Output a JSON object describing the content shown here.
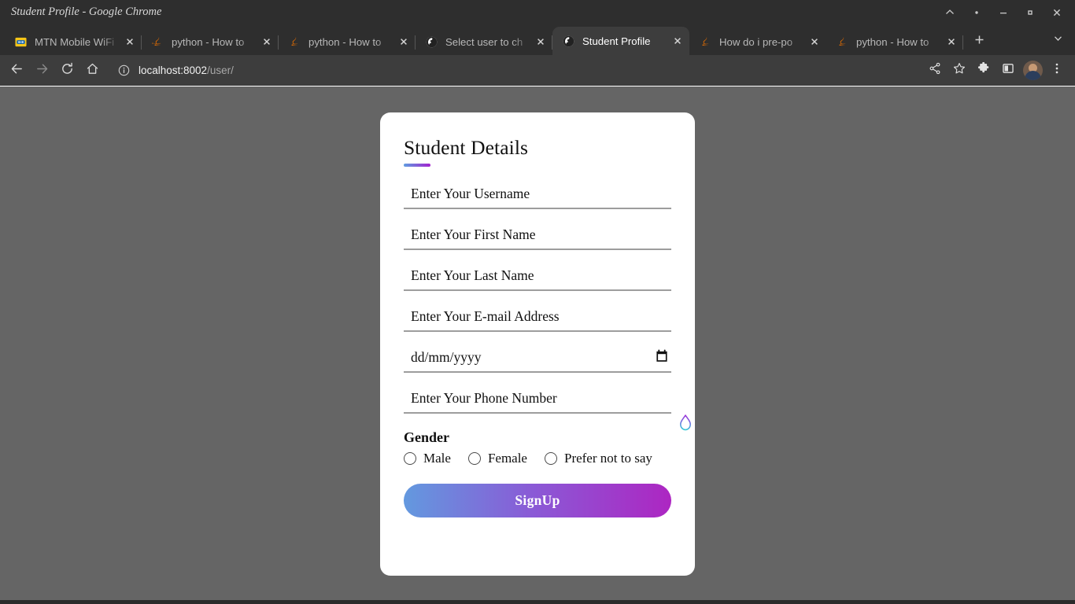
{
  "window": {
    "title": "Student Profile - Google Chrome",
    "controls": [
      {
        "name": "rollup-button",
        "icon": "chevron-up-icon"
      },
      {
        "name": "shade-button",
        "icon": "dot-icon"
      },
      {
        "name": "minimize-button",
        "icon": "minimize-icon"
      },
      {
        "name": "maximize-button",
        "icon": "maximize-icon"
      },
      {
        "name": "close-button",
        "icon": "close-icon"
      }
    ]
  },
  "tabs": {
    "items": [
      {
        "title": "MTN Mobile WiFi",
        "favicon": "router-icon",
        "active": false
      },
      {
        "title": "python - How to",
        "favicon": "java-icon",
        "active": false
      },
      {
        "title": "python - How to",
        "favicon": "java-icon",
        "active": false
      },
      {
        "title": "Select user to ch",
        "favicon": "globe-icon",
        "active": false
      },
      {
        "title": "Student Profile",
        "favicon": "globe-icon",
        "active": true
      },
      {
        "title": "How do i pre-po",
        "favicon": "java-icon",
        "active": false
      },
      {
        "title": "python - How to",
        "favicon": "java-icon",
        "active": false
      }
    ],
    "close_label": "×",
    "new_tab_label": "+",
    "tab_search_label": "⌄"
  },
  "toolbar": {
    "back_label": "←",
    "forward_label": "→",
    "reload_label": "↻",
    "home_label": "⌂",
    "url_host": "localhost:8002",
    "url_path": "/user/",
    "site_info_label": "ⓘ",
    "right_icons": [
      {
        "name": "share-icon"
      },
      {
        "name": "bookmark-star-icon"
      },
      {
        "name": "extensions-puzzle-icon"
      },
      {
        "name": "side-panel-icon"
      },
      {
        "name": "profile-avatar"
      },
      {
        "name": "chrome-menu-icon"
      }
    ]
  },
  "form": {
    "title": "Student Details",
    "fields": [
      {
        "name": "username",
        "placeholder": "Enter Your Username",
        "value": "",
        "type": "text"
      },
      {
        "name": "firstname",
        "placeholder": "Enter Your First Name",
        "value": "",
        "type": "text"
      },
      {
        "name": "lastname",
        "placeholder": "Enter Your Last Name",
        "value": "",
        "type": "text"
      },
      {
        "name": "email",
        "placeholder": "Enter Your E-mail Address",
        "value": "",
        "type": "email"
      },
      {
        "name": "dob",
        "placeholder": "dd/mm/yyyy",
        "value": "",
        "type": "date"
      },
      {
        "name": "phone",
        "placeholder": "Enter Your Phone Number",
        "value": "",
        "type": "tel"
      }
    ],
    "gender": {
      "label": "Gender",
      "options": [
        {
          "label": "Male",
          "selected": false
        },
        {
          "label": "Female",
          "selected": false
        },
        {
          "label": "Prefer not to say",
          "selected": false
        }
      ]
    },
    "submit_label": "SignUp"
  },
  "theme": {
    "gradient_start": "#6399df",
    "gradient_end": "#ad26c2",
    "page_background": "#656565",
    "card_background": "#ffffff",
    "chrome_background": "#2e2e2e",
    "toolbar_background": "#3d3d3d"
  }
}
